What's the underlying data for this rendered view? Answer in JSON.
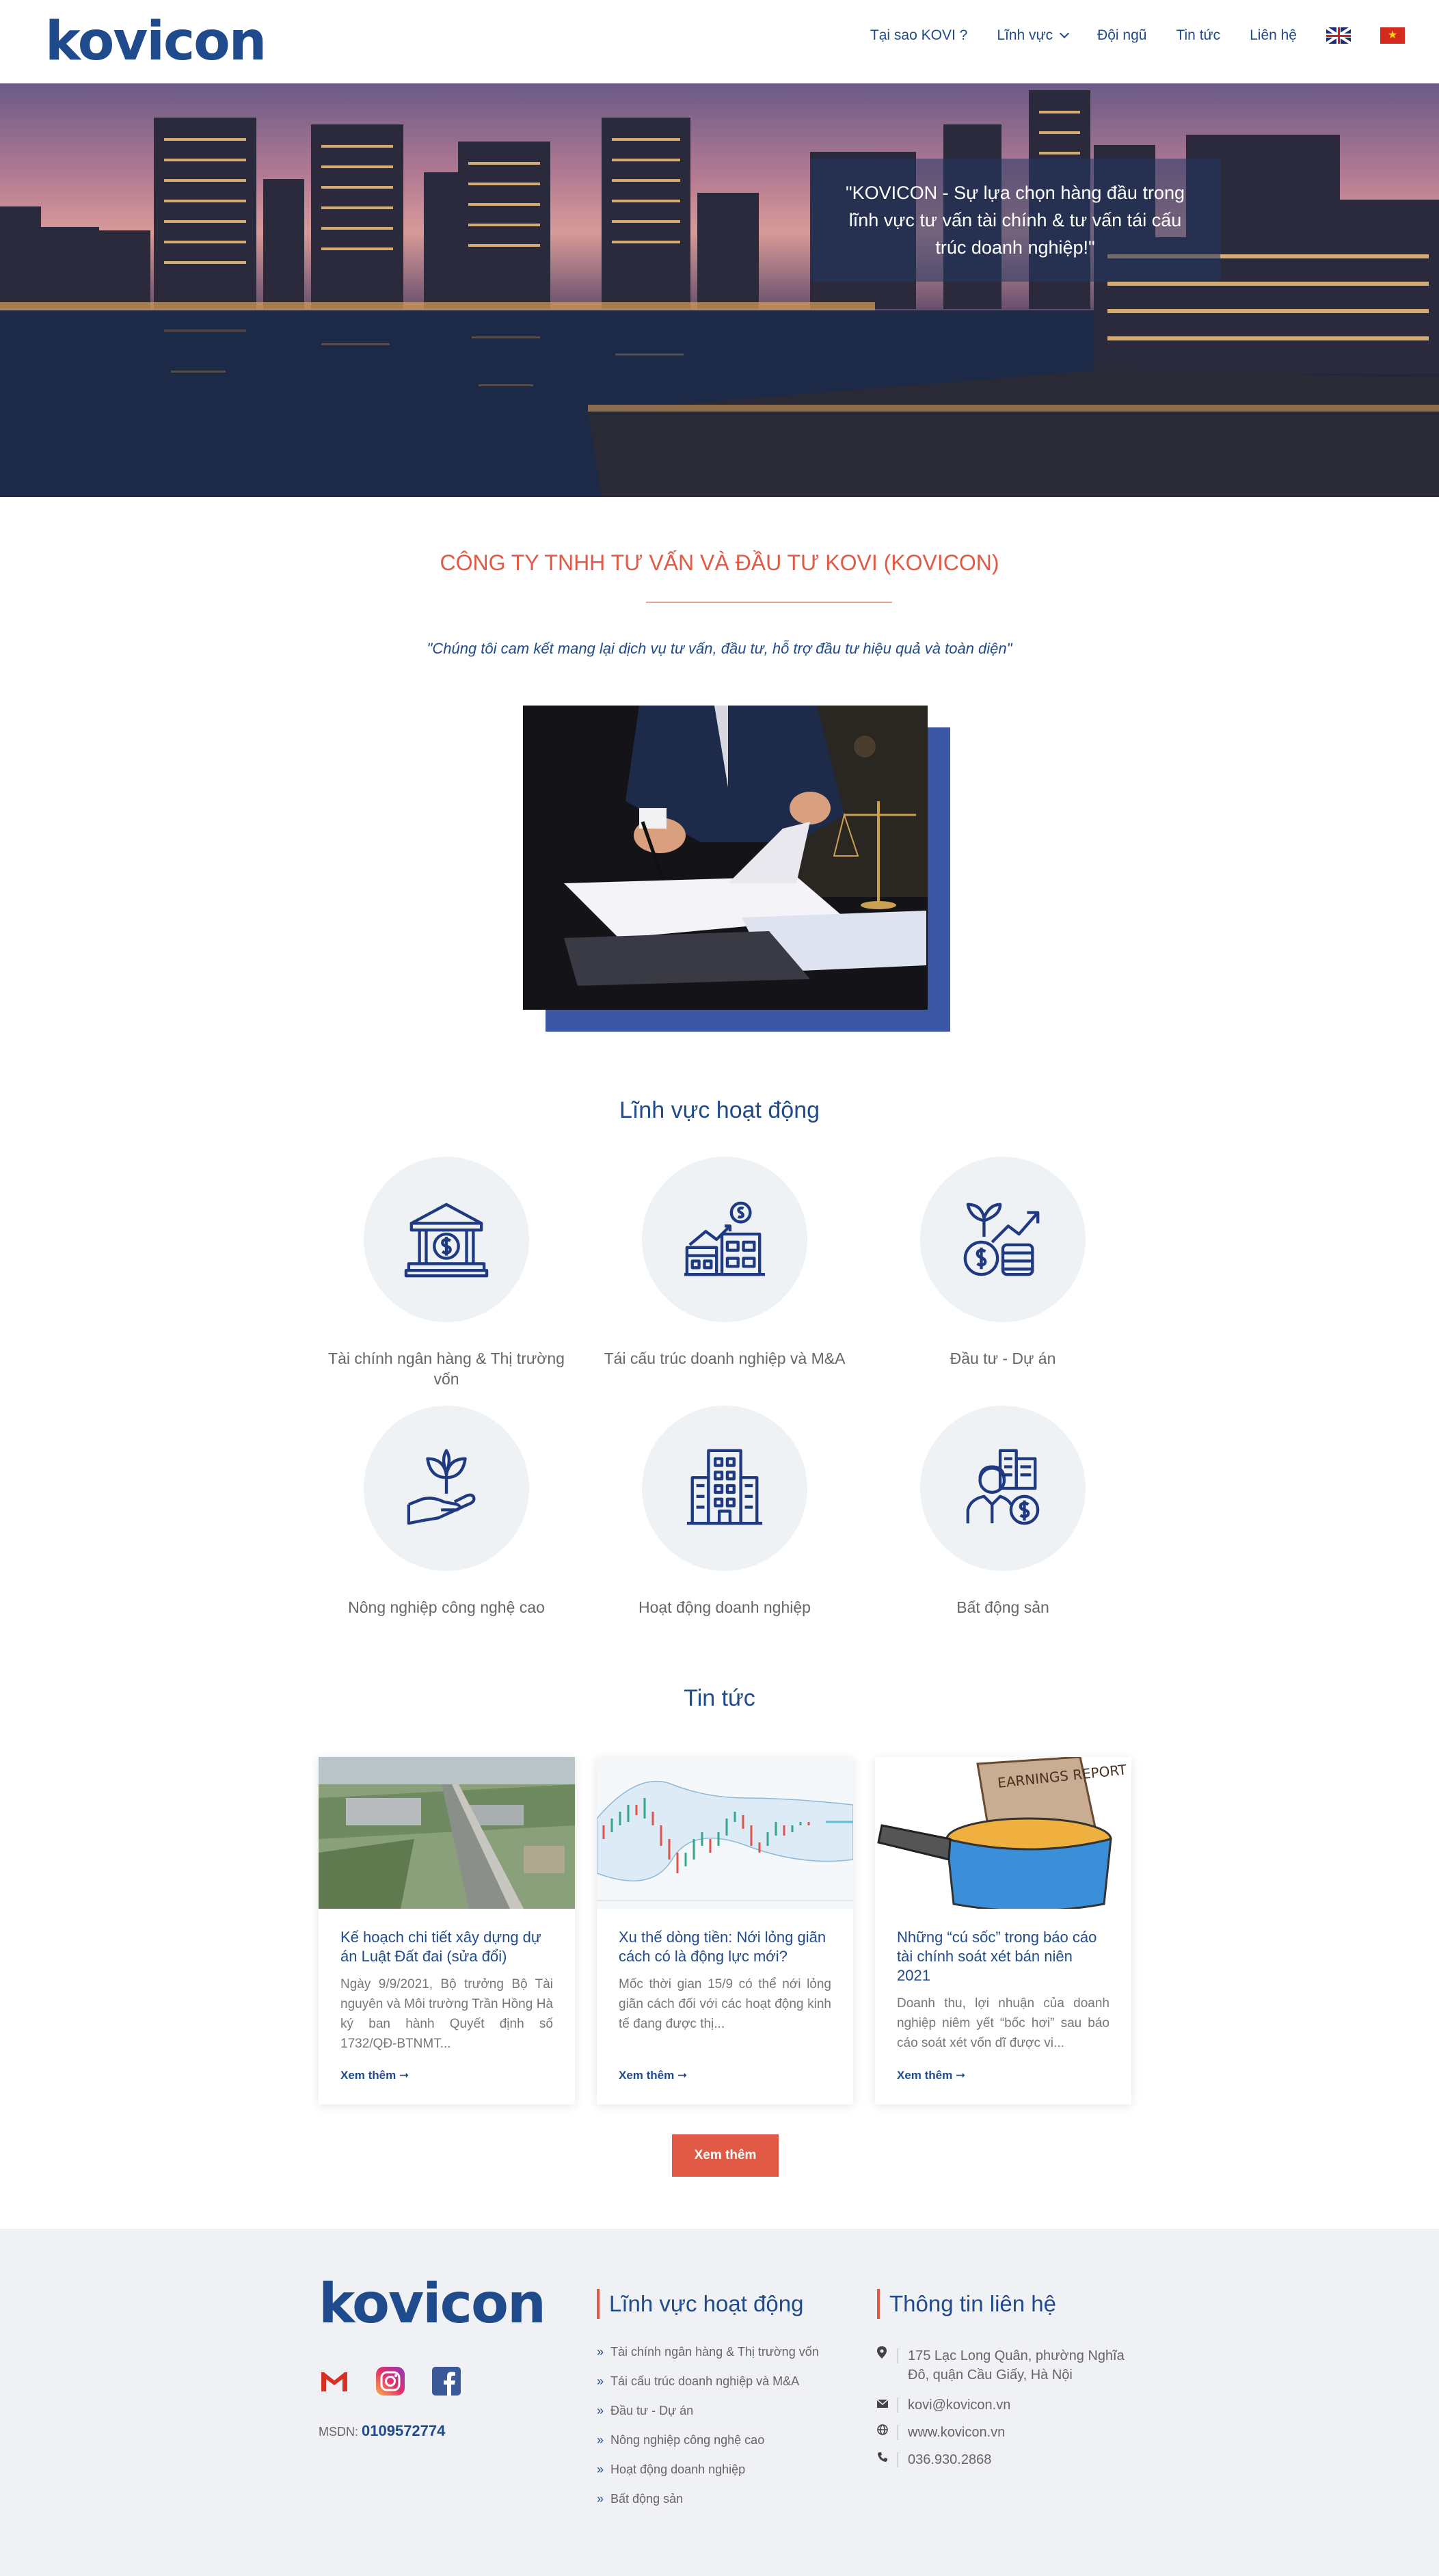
{
  "header": {
    "logo": "kovicon",
    "nav": [
      "Tại sao KOVI ?",
      "Lĩnh vực",
      "Đội ngũ",
      "Tin tức",
      "Liên hệ"
    ]
  },
  "hero": {
    "caption": "\"KOVICON - Sự lựa chọn hàng đầu trong lĩnh vực tư vấn tài chính & tư vấn tái cấu trúc doanh nghiệp!\""
  },
  "intro": {
    "company": "CÔNG TY TNHH TƯ VẤN VÀ ĐẦU TƯ KOVI (KOVICON)",
    "slogan": "\"Chúng tôi cam kết mang lại dịch vụ tư vấn, đầu tư, hỗ trợ đầu tư hiệu quả và toàn diện\""
  },
  "fields": {
    "title": "Lĩnh vực hoạt động",
    "items": [
      {
        "label": "Tài chính ngân hàng & Thị trường vốn",
        "icon": "bank-icon"
      },
      {
        "label": "Tái cấu trúc doanh nghiệp và M&A",
        "icon": "business-buildings-icon"
      },
      {
        "label": "Đầu tư - Dự án",
        "icon": "investment-growth-icon"
      },
      {
        "label": "Nông nghiệp công nghệ cao",
        "icon": "plant-hand-icon"
      },
      {
        "label": "Hoạt động doanh nghiệp",
        "icon": "office-building-icon"
      },
      {
        "label": "Bất động sản",
        "icon": "real-estate-agent-icon"
      }
    ]
  },
  "news": {
    "title": "Tin tức",
    "more_label": "Xem thêm",
    "cards": [
      {
        "title": "Kế hoạch chi tiết xây dựng dự án Luật Đất đai (sửa đổi)",
        "excerpt": "Ngày 9/9/2021, Bộ trưởng Bộ Tài nguyên và Môi trường Trần Hồng Hà ký ban hành Quyết định số 1732/QĐ-BTNMT...",
        "link": "Xem thêm ➞"
      },
      {
        "title": "Xu thế dòng tiền: Nới lỏng giãn cách có là động lực mới?",
        "excerpt": "Mốc thời gian 15/9 có thể nới lỏng giãn cách đối với các hoạt động kinh tế đang được thị...",
        "link": "Xem thêm ➞"
      },
      {
        "title": "Những “cú sốc” trong báo cáo tài chính soát xét bán niên 2021",
        "excerpt": "Doanh thu, lợi nhuận của doanh nghiệp niêm yết “bốc hơi” sau báo cáo soát xét vốn dĩ được vi...",
        "link": "Xem thêm ➞",
        "image_text": "EARNINGS REPORT"
      }
    ]
  },
  "footer": {
    "logo": "kovicon",
    "msdn_label": "MSDN:",
    "msdn_value": "0109572774",
    "fields_title": "Lĩnh vực hoạt động",
    "fields": [
      "Tài chính ngân hàng & Thị trường vốn",
      "Tái cấu trúc doanh nghiệp và M&A",
      "Đầu tư - Dự án",
      "Nông nghiệp công nghệ cao",
      "Hoạt động doanh nghiệp",
      "Bất động sản"
    ],
    "contact_title": "Thông tin liên hệ",
    "address": "175 Lạc Long Quân, phường Nghĩa Đô, quận Cầu Giấy, Hà Nội",
    "email": "kovi@kovicon.vn",
    "website": "www.kovicon.vn",
    "phone": "036.930.2868"
  },
  "colors": {
    "brand_blue": "#1f4a8b",
    "accent_red": "#e05a45",
    "footer_bg": "#eff1f4"
  }
}
